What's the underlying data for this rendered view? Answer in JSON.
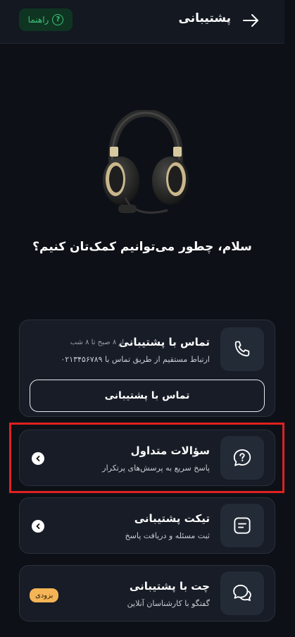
{
  "header": {
    "title": "پشتیبانی",
    "help_label": "راهنما",
    "help_icon_glyph": "?"
  },
  "greeting": "سلام، چطور می‌توانیم کمک‌تان کنیم؟",
  "contact_card": {
    "title": "تماس با پشتیبانی",
    "hours": "از ۸ صبح تا ۸ شب",
    "subtitle": "ارتباط مستقیم از طریق تماس با ۰۲۱۳۴۵۶۷۸۹",
    "button_label": "تماس با پشتیبانی",
    "icon": "phone-icon"
  },
  "faq_card": {
    "title": "سؤالات متداول",
    "subtitle": "پاسخ سریع به پرسش‌های پرتکرار",
    "icon": "question-bubble-icon"
  },
  "ticket_card": {
    "title": "تیکت پشتیبانی",
    "subtitle": "ثبت مسئله و دریافت پاسخ",
    "icon": "message-lines-icon"
  },
  "chat_card": {
    "title": "چت با پشتیبانی",
    "subtitle": "گفتگو با کارشناسان آنلاین",
    "badge": "بزودی",
    "icon": "chat-bubbles-icon"
  },
  "colors": {
    "background": "#0d1117",
    "card": "#171c26",
    "accent_green": "#3cc27a",
    "badge": "#f5b556",
    "highlight": "#e02020"
  }
}
